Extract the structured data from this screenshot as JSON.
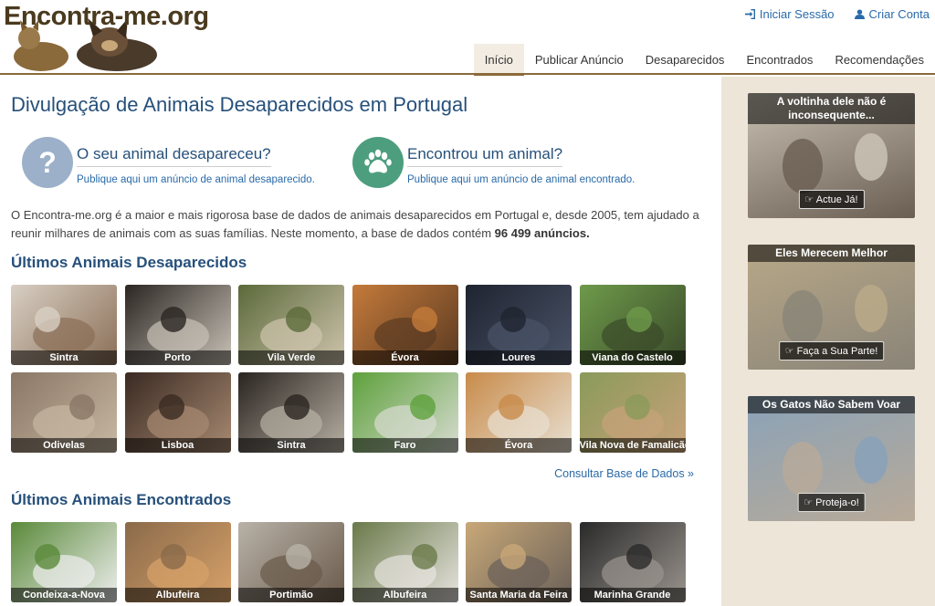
{
  "header": {
    "logo_text": "Encontra-me.org",
    "login": "Iniciar Sessão",
    "signup": "Criar Conta",
    "nav": [
      "Início",
      "Publicar Anúncio",
      "Desaparecidos",
      "Encontrados",
      "Recomendações"
    ]
  },
  "main": {
    "title": "Divulgação de Animais Desaparecidos em Portugal",
    "cta_lost": {
      "title": "O seu animal desapareceu?",
      "sub": "Publique aqui um anúncio de animal desaparecido.",
      "icon": "question-icon",
      "color": "#9cb0c9"
    },
    "cta_found": {
      "title": "Encontrou um animal?",
      "sub": "Publique aqui um anúncio de animal encontrado.",
      "icon": "paw-icon",
      "color": "#4d9e7e"
    },
    "intro_before": "O Encontra-me.org é a maior e mais rigorosa base de dados de animais desaparecidos em Portugal e, desde 2005, tem ajudado a reunir milhares de animais com as suas famílias. Neste momento, a base de dados contém ",
    "intro_count": "96 499 anúncios.",
    "lost_title": "Últimos Animais Desaparecidos",
    "lost": [
      {
        "label": "Sintra",
        "c1": "#d8cfc4",
        "c2": "#8a6e55"
      },
      {
        "label": "Porto",
        "c1": "#2b2622",
        "c2": "#c9c2b8"
      },
      {
        "label": "Vila Verde",
        "c1": "#5b6a3a",
        "c2": "#cfc4ae"
      },
      {
        "label": "Évora",
        "c1": "#c47a3a",
        "c2": "#5a3a22"
      },
      {
        "label": "Loures",
        "c1": "#1f2430",
        "c2": "#4a5368"
      },
      {
        "label": "Viana do Castelo",
        "c1": "#6e9a4a",
        "c2": "#3a4a2a"
      },
      {
        "label": "Odivelas",
        "c1": "#8a7766",
        "c2": "#c8b8a2"
      },
      {
        "label": "Lisboa",
        "c1": "#3a2a22",
        "c2": "#a88a72"
      },
      {
        "label": "Sintra",
        "c1": "#2a2420",
        "c2": "#b8b0a4"
      },
      {
        "label": "Faro",
        "c1": "#5ea13c",
        "c2": "#d8dcd2"
      },
      {
        "label": "Évora",
        "c1": "#c88b4a",
        "c2": "#e8e0d2"
      },
      {
        "label": "Vila Nova de Famalicão",
        "c1": "#8a9a5a",
        "c2": "#c8a27a"
      }
    ],
    "more_link": "Consultar Base de Dados »",
    "found_title": "Últimos Animais Encontrados",
    "found": [
      {
        "label": "Condeixa-a-Nova",
        "c1": "#5a8a3a",
        "c2": "#eeeeee"
      },
      {
        "label": "Albufeira",
        "c1": "#8a6a4a",
        "c2": "#d8a26a"
      },
      {
        "label": "Portimão",
        "c1": "#b8b2a8",
        "c2": "#6a5a4a"
      },
      {
        "label": "Albufeira",
        "c1": "#6a7a4a",
        "c2": "#e8e4e0"
      },
      {
        "label": "Santa Maria da Feira",
        "c1": "#c8a878",
        "c2": "#6a6058"
      },
      {
        "label": "Marinha Grande",
        "c1": "#2a2a2a",
        "c2": "#9a948e"
      }
    ]
  },
  "sidebar": {
    "promos": [
      {
        "title": "A voltinha dele não é inconsequente...",
        "button": "Actue Já!",
        "c1": "#c8c0b2",
        "c2": "#6a5e52"
      },
      {
        "title": "Eles Merecem Melhor",
        "button": "Faça a Sua Parte!",
        "c1": "#b8a888",
        "c2": "#8a8478"
      },
      {
        "title": "Os Gatos Não Sabem Voar",
        "button": "Proteja-o!",
        "c1": "#8aa2b8",
        "c2": "#b8aa98"
      }
    ]
  }
}
